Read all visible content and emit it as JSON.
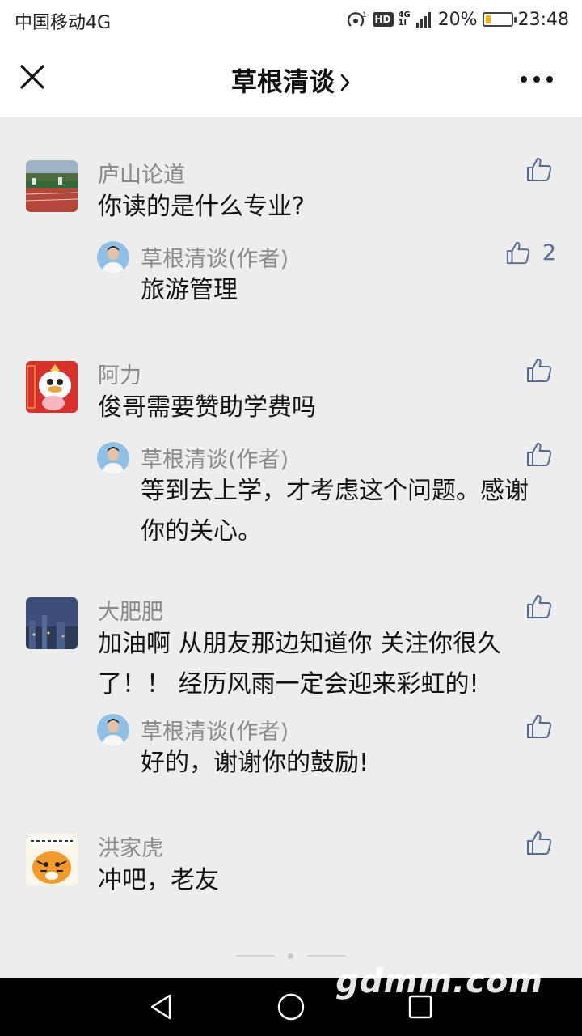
{
  "status_bar": {
    "carrier": "中国移动4G",
    "hd": "HD",
    "net_top": "4G",
    "net_bottom": "1l",
    "battery_percent": "20%",
    "battery_level": 0.2,
    "time": "23:48",
    "colors": {
      "battery": "#f4b400"
    }
  },
  "nav": {
    "title": "草根清谈",
    "icons": {
      "close": "close-icon",
      "title_chevron": "chevron-right-icon",
      "more": "more-dots-icon"
    }
  },
  "comments": [
    {
      "name": "庐山论道",
      "text": "你读的是什么专业?",
      "avatar": "photo of sports field",
      "reply": {
        "name": "草根清谈(作者)",
        "text": "旅游管理",
        "likes": "2"
      }
    },
    {
      "name": "阿力",
      "text": "俊哥需要赞助学费吗",
      "avatar": "cartoon duck sticker",
      "reply": {
        "name": "草根清谈(作者)",
        "text": "等到去上学，才考虑这个问题。感谢你的关心。"
      }
    },
    {
      "name": "大肥肥",
      "text": "加油啊 从朋友那边知道你 关注你很久了！！ 经历风雨一定会迎来彩虹的!",
      "avatar": "night city photo",
      "reply": {
        "name": "草根清谈(作者)",
        "text": "好的，谢谢你的鼓励!"
      }
    },
    {
      "name": "洪家虎",
      "text": "冲吧，老友",
      "avatar": "cartoon tiger sticker"
    }
  ],
  "system_nav": {
    "icons": [
      "back-triangle-icon",
      "home-circle-icon",
      "recents-square-icon"
    ]
  },
  "watermark": "gdmm.com",
  "colors": {
    "accent_link": "#576b95",
    "name_gray": "#8a8a8a",
    "background": "#ededed"
  }
}
